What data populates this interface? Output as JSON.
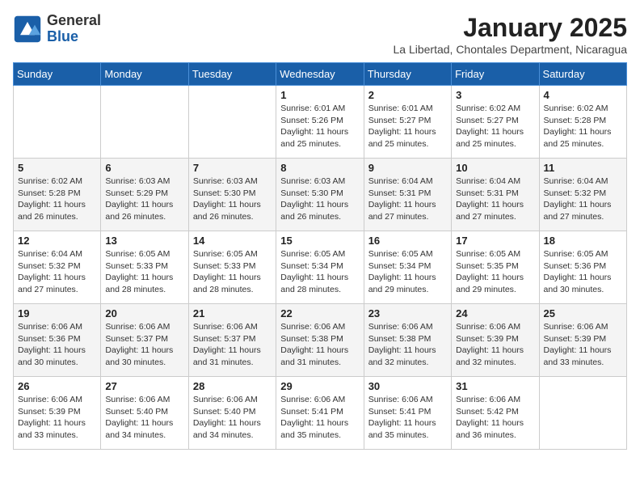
{
  "header": {
    "logo": {
      "general": "General",
      "blue": "Blue"
    },
    "month": "January 2025",
    "location": "La Libertad, Chontales Department, Nicaragua"
  },
  "weekdays": [
    "Sunday",
    "Monday",
    "Tuesday",
    "Wednesday",
    "Thursday",
    "Friday",
    "Saturday"
  ],
  "weeks": [
    [
      {
        "day": "",
        "info": ""
      },
      {
        "day": "",
        "info": ""
      },
      {
        "day": "",
        "info": ""
      },
      {
        "day": "1",
        "info": "Sunrise: 6:01 AM\nSunset: 5:26 PM\nDaylight: 11 hours and 25 minutes."
      },
      {
        "day": "2",
        "info": "Sunrise: 6:01 AM\nSunset: 5:27 PM\nDaylight: 11 hours and 25 minutes."
      },
      {
        "day": "3",
        "info": "Sunrise: 6:02 AM\nSunset: 5:27 PM\nDaylight: 11 hours and 25 minutes."
      },
      {
        "day": "4",
        "info": "Sunrise: 6:02 AM\nSunset: 5:28 PM\nDaylight: 11 hours and 25 minutes."
      }
    ],
    [
      {
        "day": "5",
        "info": "Sunrise: 6:02 AM\nSunset: 5:28 PM\nDaylight: 11 hours and 26 minutes."
      },
      {
        "day": "6",
        "info": "Sunrise: 6:03 AM\nSunset: 5:29 PM\nDaylight: 11 hours and 26 minutes."
      },
      {
        "day": "7",
        "info": "Sunrise: 6:03 AM\nSunset: 5:30 PM\nDaylight: 11 hours and 26 minutes."
      },
      {
        "day": "8",
        "info": "Sunrise: 6:03 AM\nSunset: 5:30 PM\nDaylight: 11 hours and 26 minutes."
      },
      {
        "day": "9",
        "info": "Sunrise: 6:04 AM\nSunset: 5:31 PM\nDaylight: 11 hours and 27 minutes."
      },
      {
        "day": "10",
        "info": "Sunrise: 6:04 AM\nSunset: 5:31 PM\nDaylight: 11 hours and 27 minutes."
      },
      {
        "day": "11",
        "info": "Sunrise: 6:04 AM\nSunset: 5:32 PM\nDaylight: 11 hours and 27 minutes."
      }
    ],
    [
      {
        "day": "12",
        "info": "Sunrise: 6:04 AM\nSunset: 5:32 PM\nDaylight: 11 hours and 27 minutes."
      },
      {
        "day": "13",
        "info": "Sunrise: 6:05 AM\nSunset: 5:33 PM\nDaylight: 11 hours and 28 minutes."
      },
      {
        "day": "14",
        "info": "Sunrise: 6:05 AM\nSunset: 5:33 PM\nDaylight: 11 hours and 28 minutes."
      },
      {
        "day": "15",
        "info": "Sunrise: 6:05 AM\nSunset: 5:34 PM\nDaylight: 11 hours and 28 minutes."
      },
      {
        "day": "16",
        "info": "Sunrise: 6:05 AM\nSunset: 5:34 PM\nDaylight: 11 hours and 29 minutes."
      },
      {
        "day": "17",
        "info": "Sunrise: 6:05 AM\nSunset: 5:35 PM\nDaylight: 11 hours and 29 minutes."
      },
      {
        "day": "18",
        "info": "Sunrise: 6:05 AM\nSunset: 5:36 PM\nDaylight: 11 hours and 30 minutes."
      }
    ],
    [
      {
        "day": "19",
        "info": "Sunrise: 6:06 AM\nSunset: 5:36 PM\nDaylight: 11 hours and 30 minutes."
      },
      {
        "day": "20",
        "info": "Sunrise: 6:06 AM\nSunset: 5:37 PM\nDaylight: 11 hours and 30 minutes."
      },
      {
        "day": "21",
        "info": "Sunrise: 6:06 AM\nSunset: 5:37 PM\nDaylight: 11 hours and 31 minutes."
      },
      {
        "day": "22",
        "info": "Sunrise: 6:06 AM\nSunset: 5:38 PM\nDaylight: 11 hours and 31 minutes."
      },
      {
        "day": "23",
        "info": "Sunrise: 6:06 AM\nSunset: 5:38 PM\nDaylight: 11 hours and 32 minutes."
      },
      {
        "day": "24",
        "info": "Sunrise: 6:06 AM\nSunset: 5:39 PM\nDaylight: 11 hours and 32 minutes."
      },
      {
        "day": "25",
        "info": "Sunrise: 6:06 AM\nSunset: 5:39 PM\nDaylight: 11 hours and 33 minutes."
      }
    ],
    [
      {
        "day": "26",
        "info": "Sunrise: 6:06 AM\nSunset: 5:39 PM\nDaylight: 11 hours and 33 minutes."
      },
      {
        "day": "27",
        "info": "Sunrise: 6:06 AM\nSunset: 5:40 PM\nDaylight: 11 hours and 34 minutes."
      },
      {
        "day": "28",
        "info": "Sunrise: 6:06 AM\nSunset: 5:40 PM\nDaylight: 11 hours and 34 minutes."
      },
      {
        "day": "29",
        "info": "Sunrise: 6:06 AM\nSunset: 5:41 PM\nDaylight: 11 hours and 35 minutes."
      },
      {
        "day": "30",
        "info": "Sunrise: 6:06 AM\nSunset: 5:41 PM\nDaylight: 11 hours and 35 minutes."
      },
      {
        "day": "31",
        "info": "Sunrise: 6:06 AM\nSunset: 5:42 PM\nDaylight: 11 hours and 36 minutes."
      },
      {
        "day": "",
        "info": ""
      }
    ]
  ]
}
